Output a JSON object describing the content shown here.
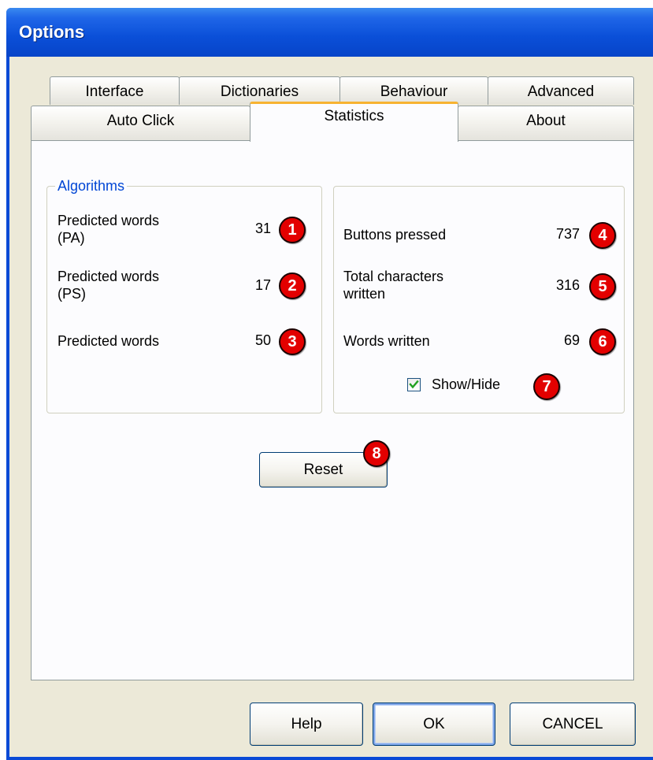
{
  "window": {
    "title": "Options"
  },
  "tabs": {
    "row1": [
      "Interface",
      "Dictionaries",
      "Behaviour",
      "Advanced"
    ],
    "row2": [
      "Auto Click",
      "Statistics",
      "About"
    ],
    "active": "Statistics"
  },
  "algorithms_group": {
    "title": "Algorithms",
    "rows": [
      {
        "label": "Predicted words\n(PA)",
        "value": "31",
        "badge": "1"
      },
      {
        "label": "Predicted words\n(PS)",
        "value": "17",
        "badge": "2"
      },
      {
        "label": "Predicted words",
        "value": "50",
        "badge": "3"
      }
    ]
  },
  "stats_group": {
    "rows": [
      {
        "label": "Buttons pressed",
        "value": "737",
        "badge": "4"
      },
      {
        "label": "Total characters\nwritten",
        "value": "316",
        "badge": "5"
      },
      {
        "label": "Words written",
        "value": "69",
        "badge": "6"
      }
    ],
    "show_hide": {
      "label": "Show/Hide",
      "checked": true,
      "badge": "7"
    }
  },
  "reset": {
    "label": "Reset",
    "badge": "8"
  },
  "footer": {
    "help": "Help",
    "ok": "OK",
    "cancel": "CANCEL"
  },
  "colors": {
    "titlebar": "#0a4fd8",
    "face": "#ece9d8",
    "active_tab_accent": "#f7b331",
    "group_title": "#0046d5",
    "badge": "#e30000",
    "check": "#21a121"
  }
}
